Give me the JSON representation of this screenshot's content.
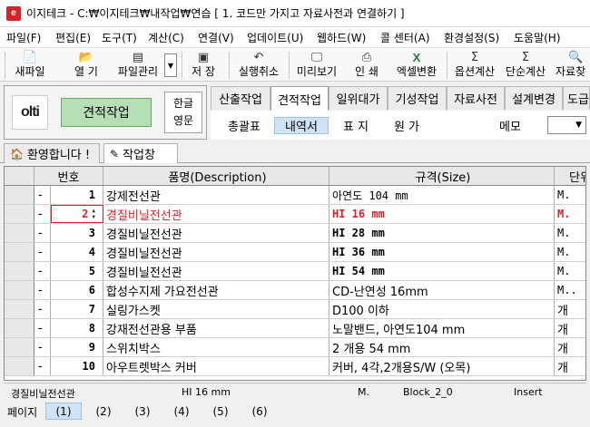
{
  "window": {
    "title": "이지테크 - C:₩이지테크₩내작업₩연습 [ 1. 코드만 가지고 자료사전과 연결하기 ]",
    "app_icon": "e"
  },
  "menu": [
    "파일(F)",
    "편집(E)",
    "도구(T)",
    "계산(C)",
    "연결(V)",
    "업데이트(U)",
    "웹하드(W)",
    "콜 센터(A)",
    "환경설정(S)",
    "도움말(H)"
  ],
  "toolbar": {
    "buttons": [
      {
        "label": "새파일",
        "icon": "new-file-icon"
      },
      {
        "label": "열 기",
        "icon": "open-folder-icon"
      },
      {
        "label": "파일관리",
        "icon": "file-manage-icon"
      },
      {
        "label": "저 장",
        "icon": "save-disk-icon"
      },
      {
        "label": "실행취소",
        "icon": "undo-icon"
      },
      {
        "label": "미리보기",
        "icon": "preview-icon"
      },
      {
        "label": "인 쇄",
        "icon": "printer-icon"
      },
      {
        "label": "엑셀변환",
        "icon": "excel-icon"
      },
      {
        "label": "옵션계산",
        "icon": "sigma-icon"
      },
      {
        "label": "단순계산",
        "icon": "sigma-icon"
      },
      {
        "label": "자료찾",
        "icon": "magnifier-icon"
      }
    ]
  },
  "mode_panel": {
    "logo_text": "olti",
    "mode_button": "견적작업",
    "lang_1": "한글",
    "lang_2": "영문"
  },
  "tabs": [
    {
      "label": "산출작업",
      "active": false
    },
    {
      "label": "견적작업",
      "active": true
    },
    {
      "label": "일위대가",
      "active": false
    },
    {
      "label": "기성작업",
      "active": false
    },
    {
      "label": "자료사전",
      "active": false
    },
    {
      "label": "설계변경",
      "active": false
    },
    {
      "label": "도급",
      "active": false
    }
  ],
  "subtabs": [
    {
      "label": "총괄표",
      "active": false
    },
    {
      "label": "내역서",
      "active": true
    },
    {
      "label": "표 지",
      "active": false
    },
    {
      "label": "원 가",
      "active": false
    },
    {
      "label": "메모",
      "active": false
    }
  ],
  "doc_tabs": [
    {
      "label": "환영합니다 !",
      "icon": "home-icon",
      "active": false
    },
    {
      "label": "작업창",
      "icon": "edit-doc-icon",
      "active": true
    }
  ],
  "grid": {
    "headers": {
      "no": "번호",
      "name": "품명(Description)",
      "spec": "규격(Size)",
      "unit": "단위"
    },
    "rows": [
      {
        "mark": "-",
        "no": "1",
        "name": "강제전선관",
        "spec": "아연도 104 mm",
        "unit": "M."
      },
      {
        "mark": "-",
        "no": "2",
        "name": "경질비닐전선관",
        "spec": "HI 16 mm",
        "unit": "M.",
        "selected": true
      },
      {
        "mark": "-",
        "no": "3",
        "name": "경질비닐전선관",
        "spec": "HI 28 mm",
        "unit": "M."
      },
      {
        "mark": "-",
        "no": "4",
        "name": "경질비닐전선관",
        "spec": "HI 36 mm",
        "unit": "M."
      },
      {
        "mark": "-",
        "no": "5",
        "name": "경질비닐전선관",
        "spec": "HI 54 mm",
        "unit": "M."
      },
      {
        "mark": "-",
        "no": "6",
        "name": "합성수지제 가요전선관",
        "spec": "CD-난연성 16mm",
        "unit": "M.."
      },
      {
        "mark": "-",
        "no": "7",
        "name": "실링가스켓",
        "spec": "D100 이하",
        "unit": "개"
      },
      {
        "mark": "-",
        "no": "8",
        "name": "강재전선관용 부품",
        "spec": "노말밴드, 아연도104 mm",
        "unit": "개"
      },
      {
        "mark": "-",
        "no": "9",
        "name": "스위치박스",
        "spec": "2 개용 54 mm",
        "unit": "개"
      },
      {
        "mark": "-",
        "no": "10",
        "name": "아우트렛박스 커버",
        "spec": "커버, 4각,2개용S/W (오목)",
        "unit": "개"
      }
    ]
  },
  "status": {
    "name": "경질비닐전선관",
    "spec": "HI 16 mm",
    "unit": "M.",
    "block": "Block_2_0",
    "mode": "Insert"
  },
  "pages": {
    "label": "페이지",
    "items": [
      "(1)",
      "(2)",
      "(3)",
      "(4)",
      "(5)",
      "(6)"
    ]
  },
  "colors": {
    "accent_red": "#d8232a",
    "mode_green": "#b6dfb6",
    "active_blue": "#cfe3f5",
    "excel_green": "#1e7d3a"
  }
}
